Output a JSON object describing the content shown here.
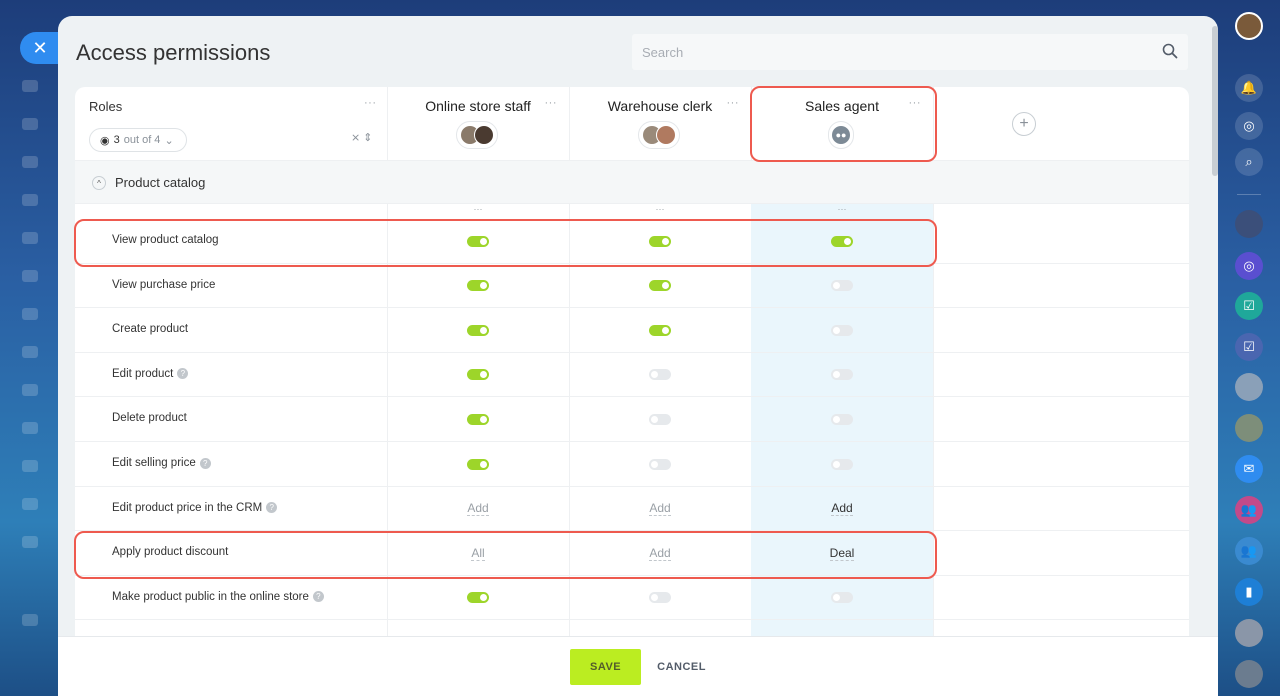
{
  "title": "Access permissions",
  "search": {
    "placeholder": "Search"
  },
  "roles": {
    "label": "Roles",
    "filter_count": "3",
    "filter_rest": "out of 4",
    "menu": "···"
  },
  "columns": [
    {
      "name": "Online store staff",
      "menu": "···"
    },
    {
      "name": "Warehouse clerk",
      "menu": "···"
    },
    {
      "name": "Sales agent",
      "menu": "···"
    }
  ],
  "add_column_glyph": "+",
  "section": {
    "label": "Product catalog",
    "chevron": "^"
  },
  "column_dots": "···",
  "rows": [
    {
      "label": "View product catalog",
      "help": false,
      "values": [
        "on",
        "on",
        "on"
      ]
    },
    {
      "label": "View purchase price",
      "help": false,
      "values": [
        "on",
        "on",
        "off"
      ]
    },
    {
      "label": "Create product",
      "help": false,
      "values": [
        "on",
        "on",
        "off"
      ]
    },
    {
      "label": "Edit product",
      "help": true,
      "values": [
        "on",
        "off",
        "off"
      ]
    },
    {
      "label": "Delete product",
      "help": false,
      "values": [
        "on",
        "off",
        "off"
      ]
    },
    {
      "label": "Edit selling price",
      "help": true,
      "values": [
        "on",
        "off",
        "off"
      ]
    },
    {
      "label": "Edit product price in the CRM",
      "help": true,
      "values": [
        "text:Add",
        "text:Add",
        "textdark:Add"
      ]
    },
    {
      "label": "Apply product discount",
      "help": false,
      "values": [
        "text:All",
        "text:Add",
        "textdark:Deal"
      ]
    },
    {
      "label": "Make product public in the online store",
      "help": true,
      "values": [
        "on",
        "off",
        "off"
      ]
    }
  ],
  "footer": {
    "save": "SAVE",
    "cancel": "CANCEL"
  },
  "colors": {
    "accent_green": "#bbed21",
    "toggle_on": "#9dd52a",
    "highlight": "#ee5a4f",
    "close_button": "#2f8cf0"
  }
}
